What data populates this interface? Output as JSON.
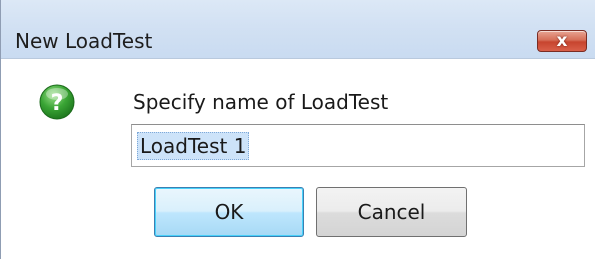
{
  "window": {
    "title": "New LoadTest",
    "close_glyph": "x"
  },
  "dialog": {
    "icon": "question-mark-icon",
    "prompt": "Specify name of LoadTest",
    "input_value": "LoadTest 1"
  },
  "buttons": {
    "ok_label": "OK",
    "cancel_label": "Cancel"
  },
  "colors": {
    "titlebar": "#d2e1f3",
    "close_button": "#c7452f",
    "icon_green": "#3aa535",
    "selection": "#cde3f9"
  }
}
